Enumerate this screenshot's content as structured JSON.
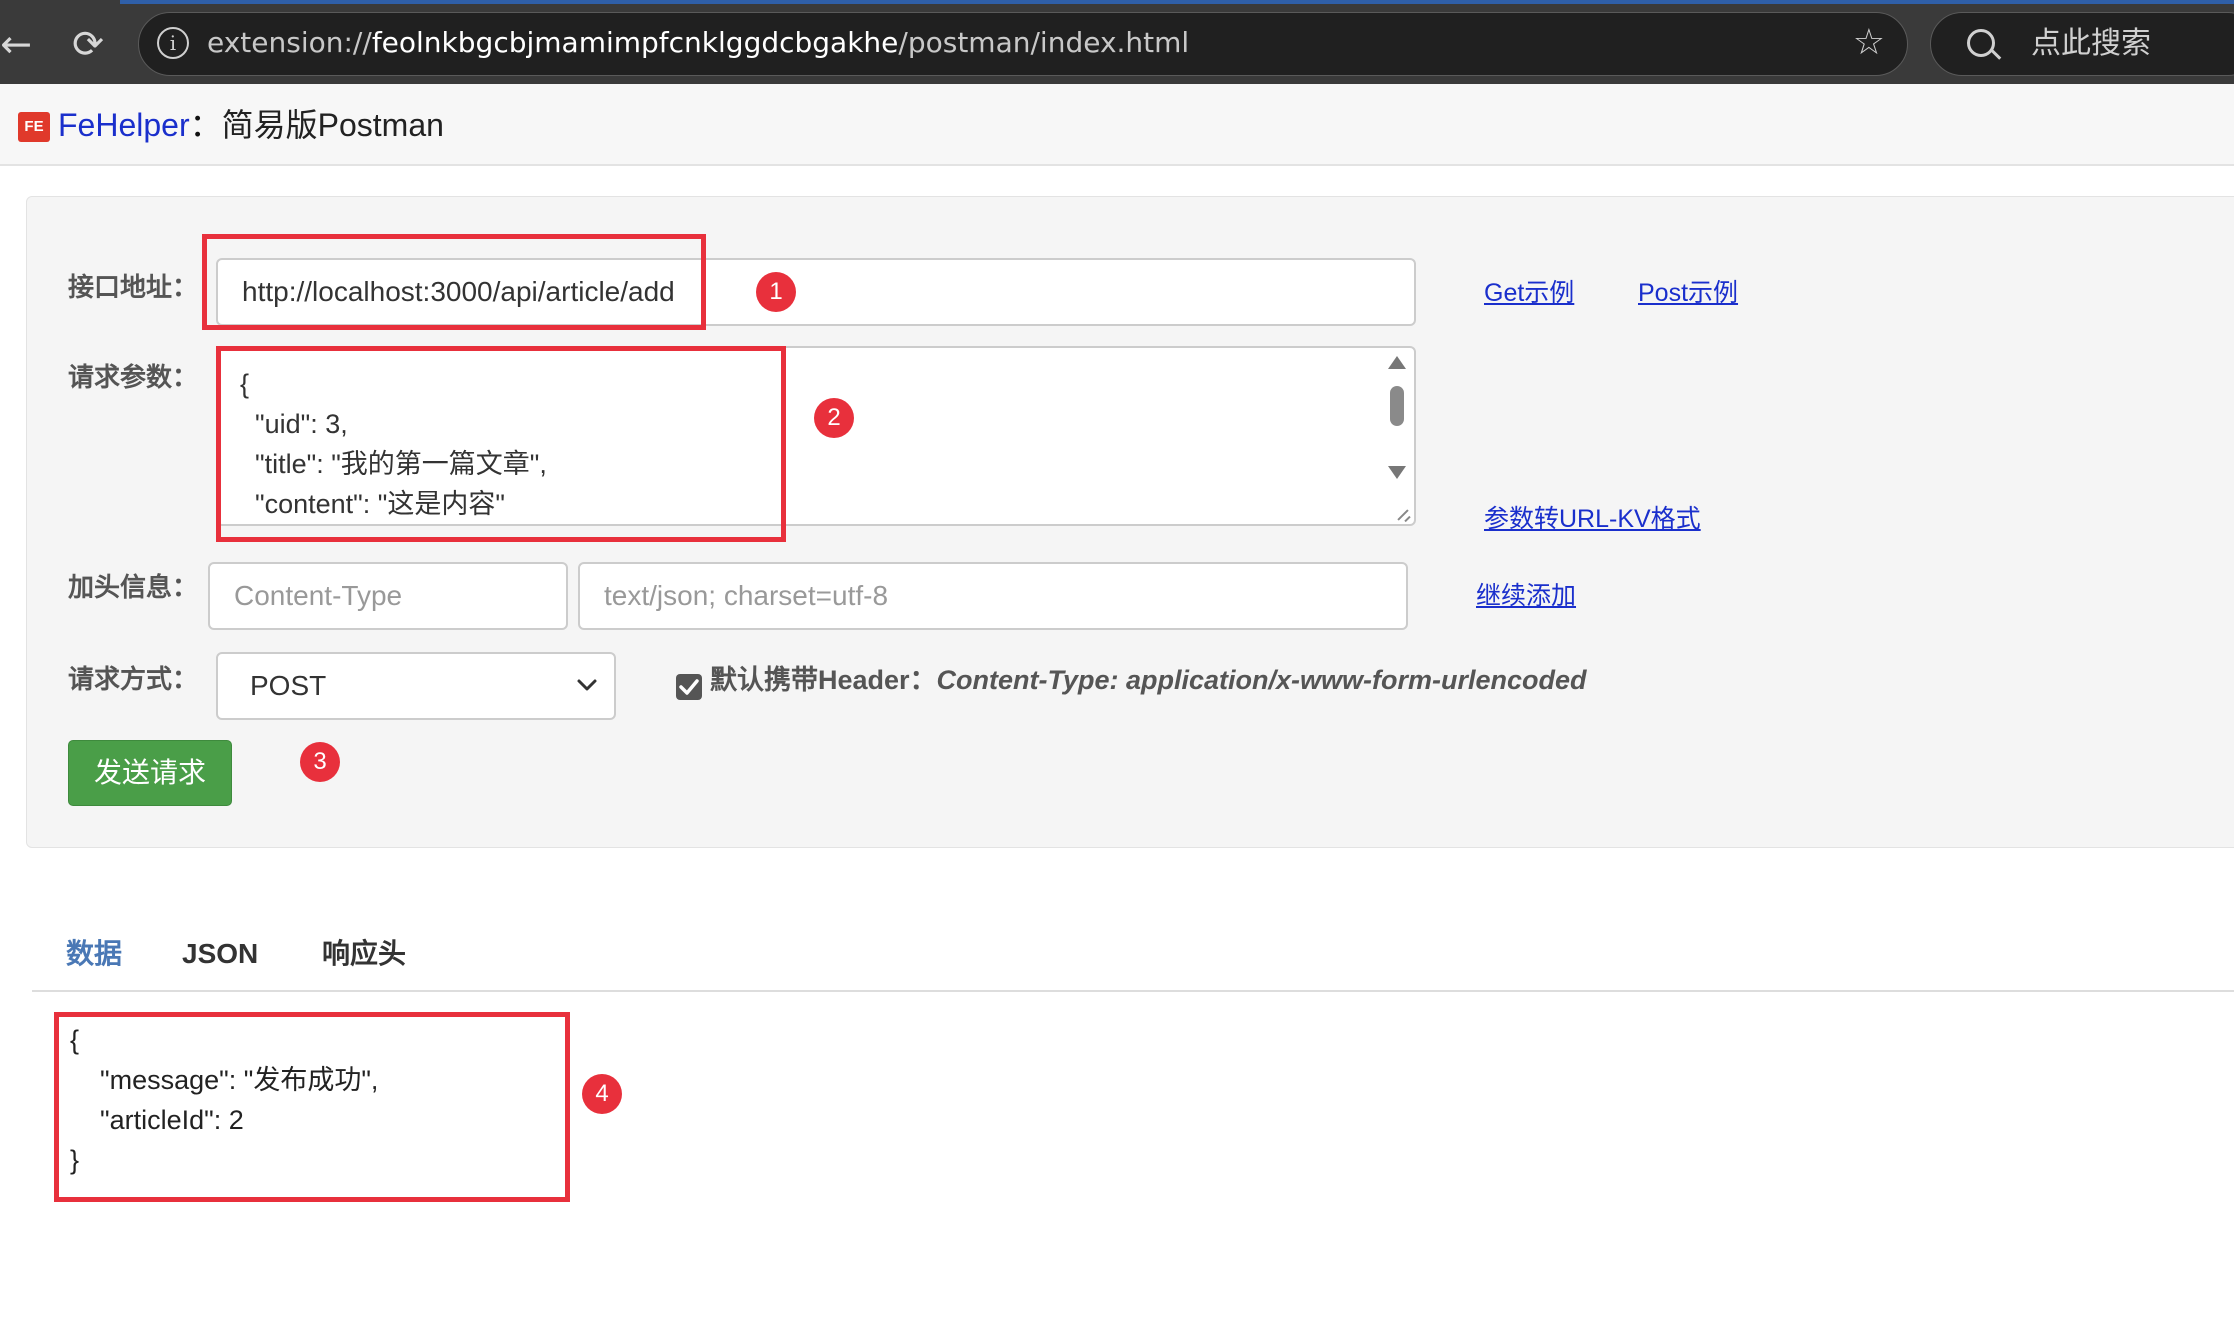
{
  "browser": {
    "url_prefix": "extension://",
    "url_host": "feolnkbgcbjmamimpfcnklggdcbgakhe",
    "url_path": "/postman/index.html",
    "search_placeholder": "点此搜索"
  },
  "header": {
    "logo_text": "FE",
    "brand": "FeHelper",
    "separator": "：",
    "subtitle": "简易版Postman"
  },
  "form": {
    "url_label": "接口地址：",
    "url_value": "http://localhost:3000/api/article/add",
    "get_example_link": "Get示例",
    "post_example_link": "Post示例",
    "params_label": "请求参数：",
    "params_value": "{\n  \"uid\": 3,\n  \"title\": \"我的第一篇文章\",\n  \"content\": \"这是内容\"",
    "params_to_kv_link": "参数转URL-KV格式",
    "header_label": "加头信息：",
    "header_key_placeholder": "Content-Type",
    "header_value_placeholder": "text/json; charset=utf-8",
    "add_more_link": "继续添加",
    "method_label": "请求方式：",
    "method_value": "POST",
    "default_header_checked": true,
    "default_header_key": "默认携带Header：",
    "default_header_value": "Content-Type: application/x-www-form-urlencoded",
    "send_button": "发送请求"
  },
  "tabs": [
    {
      "label": "数据",
      "active": true
    },
    {
      "label": "JSON",
      "active": false
    },
    {
      "label": "响应头",
      "active": false
    }
  ],
  "response": "{\n    \"message\": \"发布成功\",\n    \"articleId\": 2\n}",
  "annotations": [
    "1",
    "2",
    "3",
    "4"
  ],
  "colors": {
    "annotation": "#e8303c",
    "send_button": "#4a9e48",
    "link": "#1a2fcc",
    "active_tab": "#4a78b5"
  }
}
